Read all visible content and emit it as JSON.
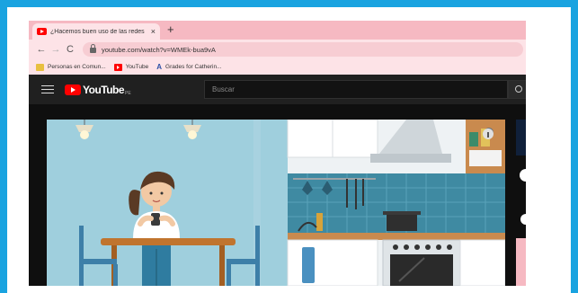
{
  "browser": {
    "tab": {
      "title": "¿Hacemos buen uso de las redes",
      "close": "×"
    },
    "new_tab": "+",
    "nav": {
      "back": "←",
      "forward": "→",
      "reload": "C"
    },
    "url": "youtube.com/watch?v=WMEk-bua9vA",
    "bookmarks": [
      {
        "label": "Personas en Comun...",
        "icon": "people-icon"
      },
      {
        "label": "YouTube",
        "icon": "youtube-icon"
      },
      {
        "label": "Grades for Catherin...",
        "icon": "A"
      }
    ]
  },
  "youtube": {
    "logo": "YouTube",
    "region": "PE",
    "search_placeholder": "Buscar"
  },
  "colors": {
    "outer_border": "#1aa3e0",
    "tabstrip": "#f6b9c2",
    "toolbar": "#fde3e7",
    "yt_header": "#202020",
    "yt_red": "#ff0000"
  }
}
